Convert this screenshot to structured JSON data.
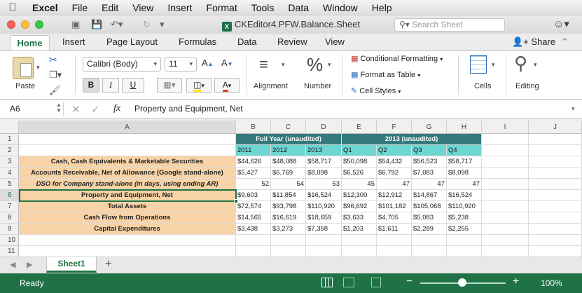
{
  "menubar": {
    "items": [
      "Excel",
      "File",
      "Edit",
      "View",
      "Insert",
      "Format",
      "Tools",
      "Data",
      "Window",
      "Help"
    ]
  },
  "window": {
    "title": "CKEditor4.PFW.Balance.Sheet",
    "search_placeholder": "Search Sheet"
  },
  "ribbon_tabs": {
    "home": "Home",
    "insert": "Insert",
    "page_layout": "Page Layout",
    "formulas": "Formulas",
    "data": "Data",
    "review": "Review",
    "view": "View",
    "share": "Share"
  },
  "ribbon": {
    "paste": "Paste",
    "font_name": "Calibri (Body)",
    "font_size": "11",
    "bold": "B",
    "italic": "I",
    "underline": "U",
    "alignment": "Alignment",
    "number_symbol": "%",
    "number": "Number",
    "conditional_formatting": "Conditional Formatting",
    "format_as_table": "Format as Table",
    "cell_styles": "Cell Styles",
    "cells": "Cells",
    "editing": "Editing",
    "font_color_accent": "#e03c31",
    "fill_color_accent": "#ffe600"
  },
  "formula_bar": {
    "name_box": "A6",
    "fx": "fx",
    "content": "Property and Equipment, Net"
  },
  "grid": {
    "columns": [
      "A",
      "B",
      "C",
      "D",
      "E",
      "F",
      "G",
      "H",
      "I",
      "J"
    ],
    "rows": [
      "1",
      "2",
      "3",
      "4",
      "5",
      "6",
      "7",
      "8",
      "9",
      "10",
      "11"
    ],
    "header_full_year": "Full Year (unaudited)",
    "header_2013": "2013 (unaudited)",
    "periods": [
      "2011",
      "2012",
      "2013",
      "Q1",
      "Q2",
      "Q3",
      "Q4"
    ],
    "labels": [
      "Cash, Cash Equivalents & Marketable Securities",
      "Accounts Receivable, Net of Allowance (Google stand-alone)",
      "DSO for Company stand-alone (in days, using ending AR)",
      "Property and Equipment, Net",
      "Total Assets",
      "Cash Flow from Operations",
      "Capital Expenditures"
    ],
    "values": [
      [
        "$44,626",
        "$48,088",
        "$58,717",
        "$50,098",
        "$54,432",
        "$56,523",
        "$58,717"
      ],
      [
        "$5,427",
        "$6,769",
        "$8,098",
        "$6,526",
        "$6,792",
        "$7,083",
        "$8,098"
      ],
      [
        "52",
        "54",
        "53",
        "45",
        "47",
        "47",
        "47"
      ],
      [
        "$9,603",
        "$11,854",
        "$16,524",
        "$12,300",
        "$12,912",
        "$14,867",
        "$16,524"
      ],
      [
        "$72,574",
        "$93,798",
        "$110,920",
        "$96,692",
        "$101,182",
        "$105,068",
        "$110,920"
      ],
      [
        "$14,565",
        "$16,619",
        "$18,659",
        "$3,633",
        "$4,705",
        "$5,083",
        "$5,238"
      ],
      [
        "$3,438",
        "$3,273",
        "$7,358",
        "$1,203",
        "$1,611",
        "$2,289",
        "$2,255"
      ]
    ],
    "colors": {
      "label_fill": "#f8d3a7",
      "header_dark": "#347a7c",
      "header_light": "#6ed6d2"
    }
  },
  "sheet_tabs": {
    "active": "Sheet1",
    "add": "+"
  },
  "status_bar": {
    "status": "Ready",
    "zoom_minus": "−",
    "zoom_plus": "+",
    "zoom": "100%"
  }
}
